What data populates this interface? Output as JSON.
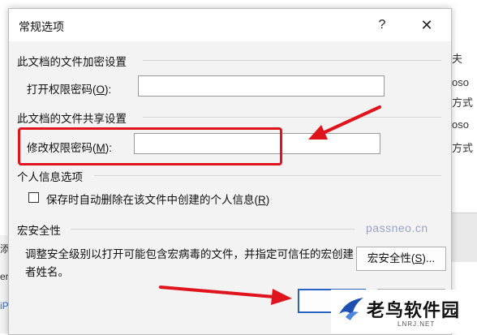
{
  "background_app": {
    "right_items": [
      "夫",
      "oso",
      "方式",
      "oso",
      "方式"
    ],
    "left_items": [
      "添",
      "er",
      "iP"
    ]
  },
  "dialog": {
    "title": "常规选项",
    "help_label": "?",
    "close_label": "✕",
    "encryption_section": {
      "heading": "此文档的文件加密设置",
      "open_password_label": "打开权限密码(",
      "open_password_hotkey": "O",
      "open_password_suffix": "):",
      "open_password_value": ""
    },
    "sharing_section": {
      "heading": "此文档的文件共享设置",
      "modify_password_label": "修改权限密码(",
      "modify_password_hotkey": "M",
      "modify_password_suffix": "):",
      "modify_password_value": ""
    },
    "privacy_section": {
      "heading": "个人信息选项",
      "remove_info_label": "保存时自动删除在该文件中创建的个人信息(",
      "remove_info_hotkey": "R",
      "remove_info_suffix": ")",
      "remove_info_checked": false
    },
    "macro_section": {
      "heading": "宏安全性",
      "description": "调整安全级别以打开可能包含宏病毒的文件，并指定可信任的宏创建者姓名。",
      "button_label": "宏安全性(",
      "button_hotkey": "S",
      "button_suffix": ")..."
    },
    "ok_label": "",
    "cancel_label": ""
  },
  "watermark": "passneo.cn",
  "brand": {
    "name": "老鸟软件园",
    "subtitle": "LNRJ.NET"
  },
  "colors": {
    "annotation_red": "#e0141c",
    "dialog_bg": "#f3f3f3"
  }
}
